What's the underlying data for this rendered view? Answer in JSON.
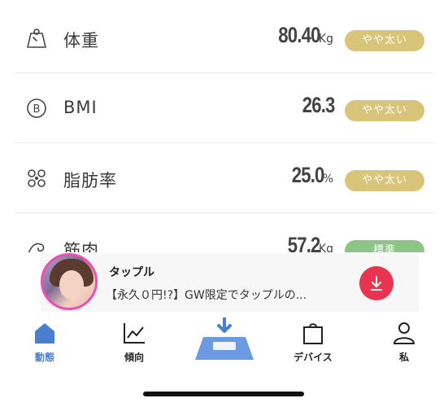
{
  "metrics": [
    {
      "icon": "weight-icon",
      "name": "体重",
      "value": "80.40",
      "unit": "Kg",
      "badge": "やや太い",
      "badge_color": "#d9c57a"
    },
    {
      "icon": "bmi-icon",
      "name": "BMI",
      "value": "26.3",
      "unit": "",
      "badge": "やや太い",
      "badge_color": "#d9c57a"
    },
    {
      "icon": "body-fat-icon",
      "name": "脂肪率",
      "value": "25.0",
      "unit": "%",
      "badge": "やや太い",
      "badge_color": "#d9c57a"
    },
    {
      "icon": "muscle-icon",
      "name": "筋肉",
      "value": "57.2",
      "unit": "Kg",
      "badge": "標準",
      "badge_color": "#8cc585"
    }
  ],
  "ad": {
    "title": "タップル",
    "description": "【永久０円!?】GW限定でタップルの...",
    "action_color": "#e8344f"
  },
  "nav": {
    "items": [
      {
        "label": "動態",
        "icon": "home-icon",
        "active": true
      },
      {
        "label": "傾向",
        "icon": "trend-chart-icon",
        "active": false
      },
      {
        "label": "",
        "icon": "scale-measure-icon",
        "active": false
      },
      {
        "label": "デバイス",
        "icon": "device-bag-icon",
        "active": false
      },
      {
        "label": "私",
        "icon": "profile-icon",
        "active": false
      }
    ],
    "active_color": "#4a7fd0"
  }
}
